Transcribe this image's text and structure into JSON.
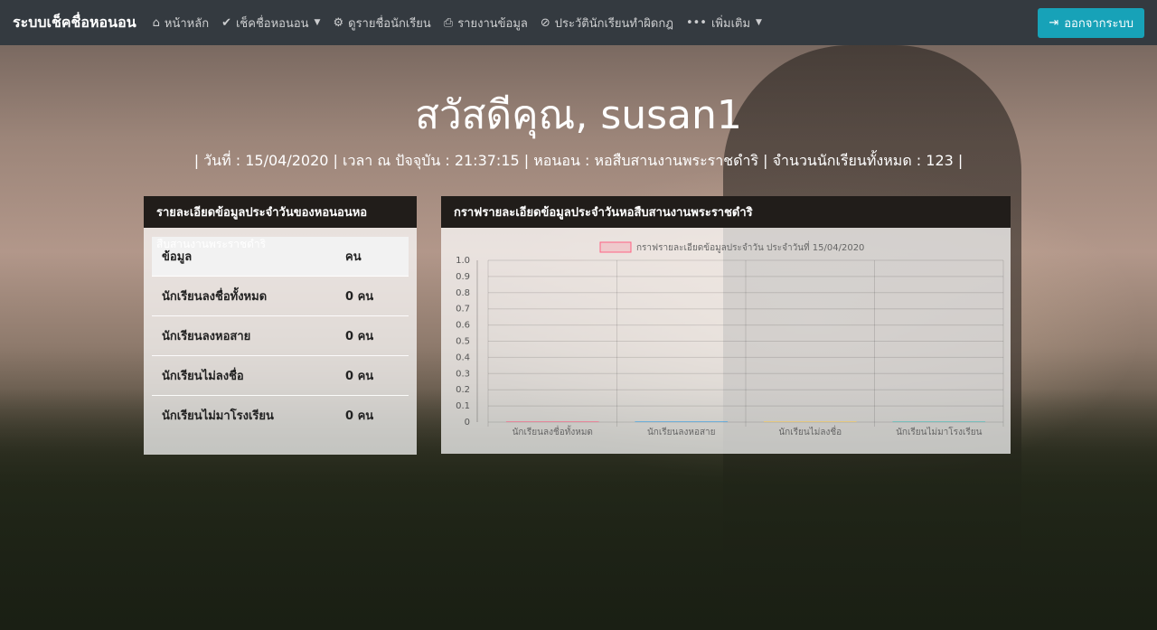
{
  "navbar": {
    "brand": "ระบบเช็คชื่อหอนอน",
    "items": [
      {
        "label": "หน้าหลัก",
        "icon": "home-icon",
        "glyph": "⌂",
        "caret": false
      },
      {
        "label": "เช็คชื่อหอนอน",
        "icon": "user-check-icon",
        "glyph": "✔",
        "caret": true
      },
      {
        "label": "ดูรายชื่อนักเรียน",
        "icon": "users-cog-icon",
        "glyph": "⚙",
        "caret": false
      },
      {
        "label": "รายงานข้อมูล",
        "icon": "print-icon",
        "glyph": "⎙",
        "caret": false
      },
      {
        "label": "ประวัตินักเรียนทำผิดกฎ",
        "icon": "user-slash-icon",
        "glyph": "⊘",
        "caret": false
      },
      {
        "label": "เพิ่มเติม",
        "icon": "ellipsis-icon",
        "glyph": "•••",
        "caret": true
      }
    ],
    "logout_label": "ออกจากระบบ"
  },
  "hero": {
    "greeting": "สวัสดีคุณ, susan1",
    "info": "| วันที่ : 15/04/2020 | เวลา ณ ปัจจุบัน : 21:37:15 | หอนอน : หอสืบสานงานพระราชดำริ | จำนวนนักเรียนทั้งหมด : 123 |"
  },
  "left_card": {
    "header": "รายละเอียดข้อมูลประจำวันของหอนอนหอ",
    "header_overflow": "สืบสานงานพระราชดำริ",
    "columns": [
      "ข้อมูล",
      "คน"
    ],
    "rows": [
      {
        "label": "นักเรียนลงชื่อทั้งหมด",
        "value": "0 คน"
      },
      {
        "label": "นักเรียนลงหอสาย",
        "value": "0 คน"
      },
      {
        "label": "นักเรียนไม่ลงชื่อ",
        "value": "0 คน"
      },
      {
        "label": "นักเรียนไม่มาโรงเรียน",
        "value": "0 คน"
      }
    ]
  },
  "right_card": {
    "header": "กราฟรายละเอียดข้อมูลประจำวันหอสืบสานงานพระราชดำริ"
  },
  "chart_data": {
    "type": "bar",
    "legend": "กราฟรายละเอียดข้อมูลประจำวัน ประจำวันที่ 15/04/2020",
    "legend_position": "top",
    "categories": [
      "นักเรียนลงชื่อทั้งหมด",
      "นักเรียนลงหอสาย",
      "นักเรียนไม่ลงชื่อ",
      "นักเรียนไม่มาโรงเรียน"
    ],
    "values": [
      0,
      0,
      0,
      0
    ],
    "ylim": [
      0,
      1.0
    ],
    "yticks": [
      "0",
      "0.1",
      "0.2",
      "0.3",
      "0.4",
      "0.5",
      "0.6",
      "0.7",
      "0.8",
      "0.9",
      "1.0"
    ],
    "grid": true,
    "colors": [
      "#ff6384",
      "#36a2eb",
      "#ffce56",
      "#4bc0c0"
    ],
    "legend_color": "#ff6384"
  }
}
